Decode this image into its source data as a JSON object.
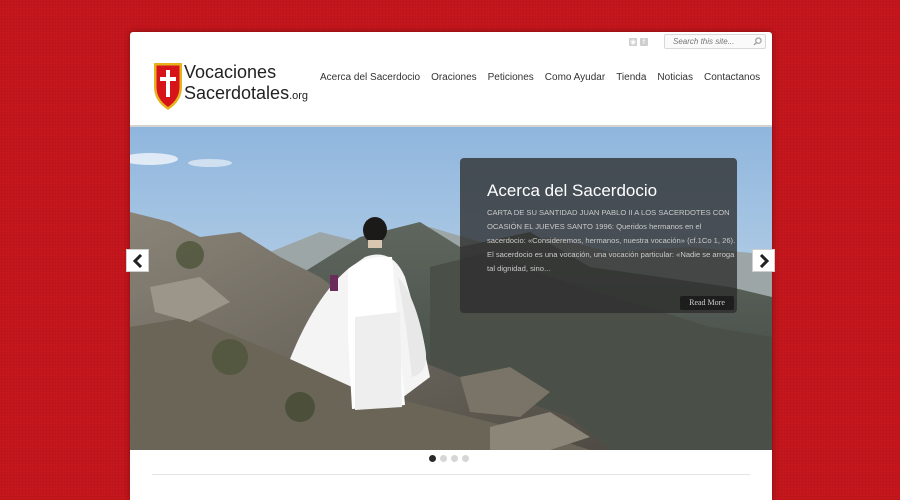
{
  "header": {
    "social_icons": [
      "rss-icon",
      "facebook-icon"
    ],
    "search": {
      "placeholder": "Search this site..."
    },
    "logo": {
      "line1": "Vocaciones",
      "line2": "Sacerdotales",
      "suffix": ".org"
    }
  },
  "nav": {
    "items": [
      {
        "label": "Acerca del Sacerdocio"
      },
      {
        "label": "Oraciones"
      },
      {
        "label": "Peticiones"
      },
      {
        "label": "Como Ayudar"
      },
      {
        "label": "Tienda"
      },
      {
        "label": "Noticias"
      },
      {
        "label": "Contactanos"
      }
    ]
  },
  "slider": {
    "caption_title": "Acerca del Sacerdocio",
    "caption_text": "CARTA DE SU SANTIDAD JUAN PABLO II A LOS SACERDOTES CON OCASIÓN EL JUEVES SANTO 1996: Queridos hermanos en el sacerdocio: «Consideremos, hermanos, nuestra vocación» (cf.1Co 1, 26). El sacerdocio es una vocación, una vocación particular: «Nadie se arroga tal dignidad, sino...",
    "read_more": "Read More",
    "slide_count": 4,
    "active_slide": 1
  },
  "colors": {
    "background": "#c4161c",
    "shield_red": "#d7141a",
    "shield_gold": "#e6b21f",
    "caption_bg": "#2d2d2d"
  }
}
